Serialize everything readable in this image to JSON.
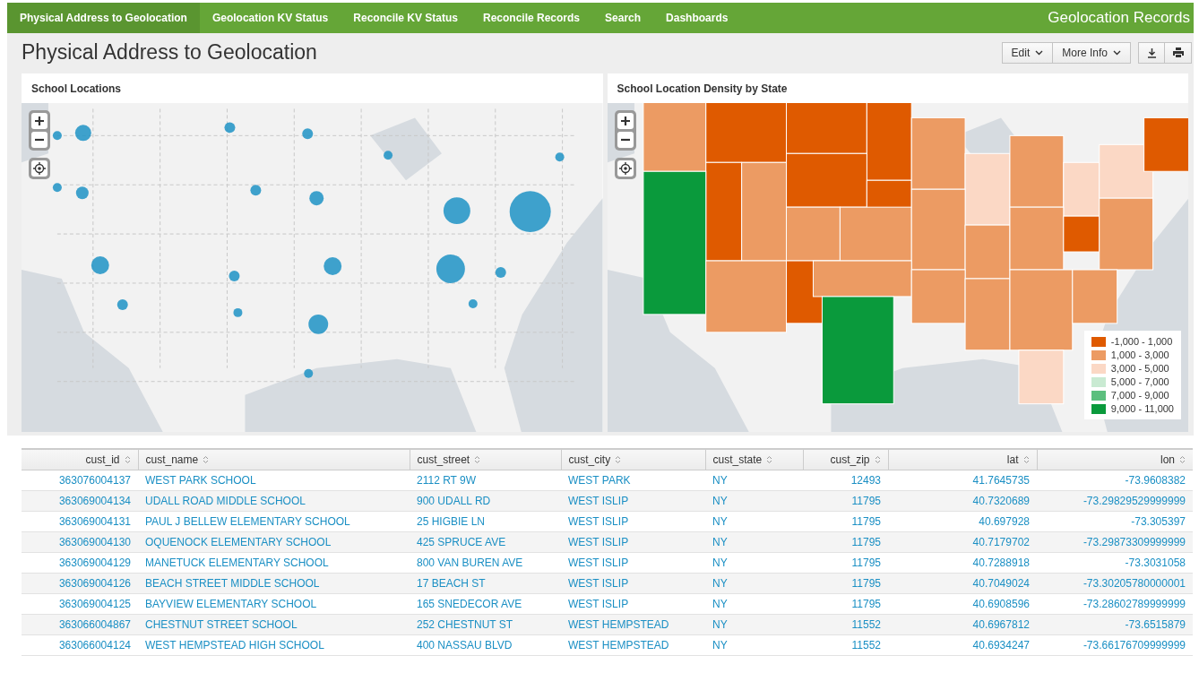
{
  "nav": {
    "items": [
      {
        "label": "Physical Address to Geolocation",
        "selected": true
      },
      {
        "label": "Geolocation KV Status",
        "selected": false
      },
      {
        "label": "Reconcile KV Status",
        "selected": false
      },
      {
        "label": "Reconcile Records",
        "selected": false
      },
      {
        "label": "Search",
        "selected": false
      },
      {
        "label": "Dashboards",
        "selected": false
      }
    ],
    "app_title": "Geolocation Records"
  },
  "dashboard": {
    "title": "Physical Address to Geolocation",
    "buttons": [
      {
        "kind": "dropdown",
        "label": "Edit"
      },
      {
        "kind": "dropdown",
        "label": "More Info"
      },
      {
        "kind": "export"
      },
      {
        "kind": "print"
      }
    ]
  },
  "panels": [
    {
      "kind": "bubble-map",
      "title": "School Locations"
    },
    {
      "kind": "choropleth",
      "title": "School Location Density by State",
      "legend": [
        {
          "label": "-1,000 - 1,000",
          "color": "#df5a00"
        },
        {
          "label": "1,000 - 3,000",
          "color": "#ec9b63"
        },
        {
          "label": "3,000 - 5,000",
          "color": "#fbd8c5"
        },
        {
          "label": "5,000 - 7,000",
          "color": "#c9ead2"
        },
        {
          "label": "7,000 - 9,000",
          "color": "#5cbf7e"
        },
        {
          "label": "9,000 - 11,000",
          "color": "#0a9a3c"
        }
      ]
    }
  ],
  "table": {
    "columns": [
      "cust_id",
      "cust_name",
      "cust_street",
      "cust_city",
      "cust_state",
      "cust_zip",
      "lat",
      "lon"
    ],
    "rows": [
      [
        "363076004137",
        "WEST PARK SCHOOL",
        "2112 RT 9W",
        "WEST PARK",
        "NY",
        "12493",
        "41.7645735",
        "-73.9608382"
      ],
      [
        "363069004134",
        "UDALL ROAD MIDDLE SCHOOL",
        "900 UDALL RD",
        "WEST ISLIP",
        "NY",
        "11795",
        "40.7320689",
        "-73.29829529999999"
      ],
      [
        "363069004131",
        "PAUL J BELLEW ELEMENTARY SCHOOL",
        "25 HIGBIE LN",
        "WEST ISLIP",
        "NY",
        "11795",
        "40.697928",
        "-73.305397"
      ],
      [
        "363069004130",
        "OQUENOCK ELEMENTARY SCHOOL",
        "425 SPRUCE AVE",
        "WEST ISLIP",
        "NY",
        "11795",
        "40.7179702",
        "-73.29873309999999"
      ],
      [
        "363069004129",
        "MANETUCK ELEMENTARY SCHOOL",
        "800 VAN BUREN AVE",
        "WEST ISLIP",
        "NY",
        "11795",
        "40.7288918",
        "-73.3031058"
      ],
      [
        "363069004126",
        "BEACH STREET MIDDLE SCHOOL",
        "17 BEACH ST",
        "WEST ISLIP",
        "NY",
        "11795",
        "40.7049024",
        "-73.30205780000001"
      ],
      [
        "363069004125",
        "BAYVIEW ELEMENTARY SCHOOL",
        "165 SNEDECOR AVE",
        "WEST ISLIP",
        "NY",
        "11795",
        "40.6908596",
        "-73.28602789999999"
      ],
      [
        "363066004867",
        "CHESTNUT STREET SCHOOL",
        "252 CHESTNUT ST",
        "WEST HEMPSTEAD",
        "NY",
        "11552",
        "40.6967812",
        "-73.6515879"
      ],
      [
        "363066004124",
        "WEST HEMPSTEAD HIGH SCHOOL",
        "400 NASSAU BLVD",
        "WEST HEMPSTEAD",
        "NY",
        "11552",
        "40.6934247",
        "-73.66176709999999"
      ]
    ]
  }
}
